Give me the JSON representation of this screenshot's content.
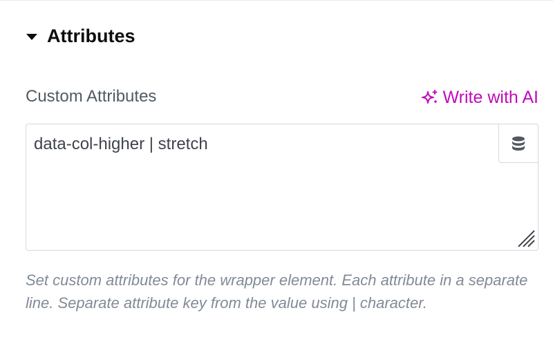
{
  "section": {
    "title": "Attributes",
    "expanded": true
  },
  "field": {
    "label": "Custom Attributes",
    "ai_button_label": "Write with AI",
    "value": "data-col-higher | stretch",
    "help_text": "Set custom attributes for the wrapper element. Each attribute in a separate line. Separate attribute key from the value using | character."
  },
  "icons": {
    "toggle": "caret-down-icon",
    "ai": "sparkle-icon",
    "dynamic_tags": "database-icon",
    "resize": "resize-handle-icon"
  },
  "colors": {
    "title": "#0c0d0e",
    "label": "#515962",
    "ai_accent": "#c00bb9",
    "help_text": "#818a96",
    "border": "#d5d8dc"
  }
}
